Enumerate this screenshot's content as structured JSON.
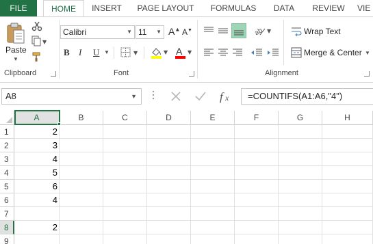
{
  "tabs": {
    "file": "FILE",
    "home": "HOME",
    "insert": "INSERT",
    "page_layout": "PAGE LAYOUT",
    "formulas": "FORMULAS",
    "data": "DATA",
    "review": "REVIEW",
    "view": "VIE"
  },
  "clipboard": {
    "paste_label": "Paste",
    "group_label": "Clipboard"
  },
  "font": {
    "name": "Calibri",
    "size": "11",
    "grow_label": "A",
    "shrink_label": "A",
    "bold": "B",
    "italic": "I",
    "underline": "U",
    "color_label": "A",
    "group_label": "Font"
  },
  "alignment": {
    "wrap_text": "Wrap Text",
    "merge_center": "Merge & Center",
    "group_label": "Alignment"
  },
  "formula_bar": {
    "name_box": "A8",
    "formula": "=COUNTIFS(A1:A6,\"4\")"
  },
  "columns": [
    "A",
    "B",
    "C",
    "D",
    "E",
    "F",
    "G",
    "H"
  ],
  "rows": [
    "1",
    "2",
    "3",
    "4",
    "5",
    "6",
    "7",
    "8",
    "9"
  ],
  "cells_A": [
    "2",
    "3",
    "4",
    "5",
    "6",
    "4",
    "",
    "2",
    ""
  ],
  "colors": {
    "excel_green": "#217346",
    "highlight_yellow": "#ffff00",
    "font_red": "#ff0000",
    "selected_align": "#9fd5b7"
  }
}
